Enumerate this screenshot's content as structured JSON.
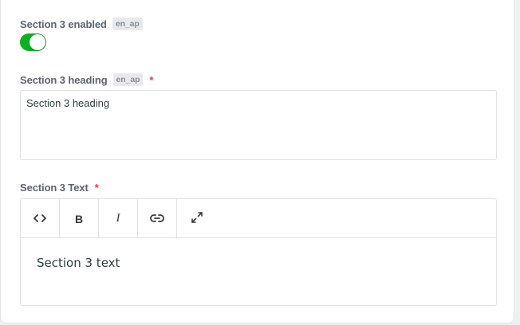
{
  "colors": {
    "toggle_on": "#0bb121",
    "required": "#e23c3c",
    "label": "#5c6270",
    "badge_bg": "#e8e9ec"
  },
  "section_enabled": {
    "label": "Section 3 enabled",
    "locale": "en_ap",
    "toggle_state": "on"
  },
  "section_heading": {
    "label": "Section 3 heading",
    "locale": "en_ap",
    "required_mark": "*",
    "value": "Section 3 heading"
  },
  "section_text": {
    "label": "Section 3 Text",
    "required_mark": "*",
    "toolbar": {
      "code_icon": "code-icon",
      "bold_label": "B",
      "italic_label": "I",
      "link_icon": "link-icon",
      "expand_icon": "expand-icon"
    },
    "content": "Section 3 text"
  }
}
